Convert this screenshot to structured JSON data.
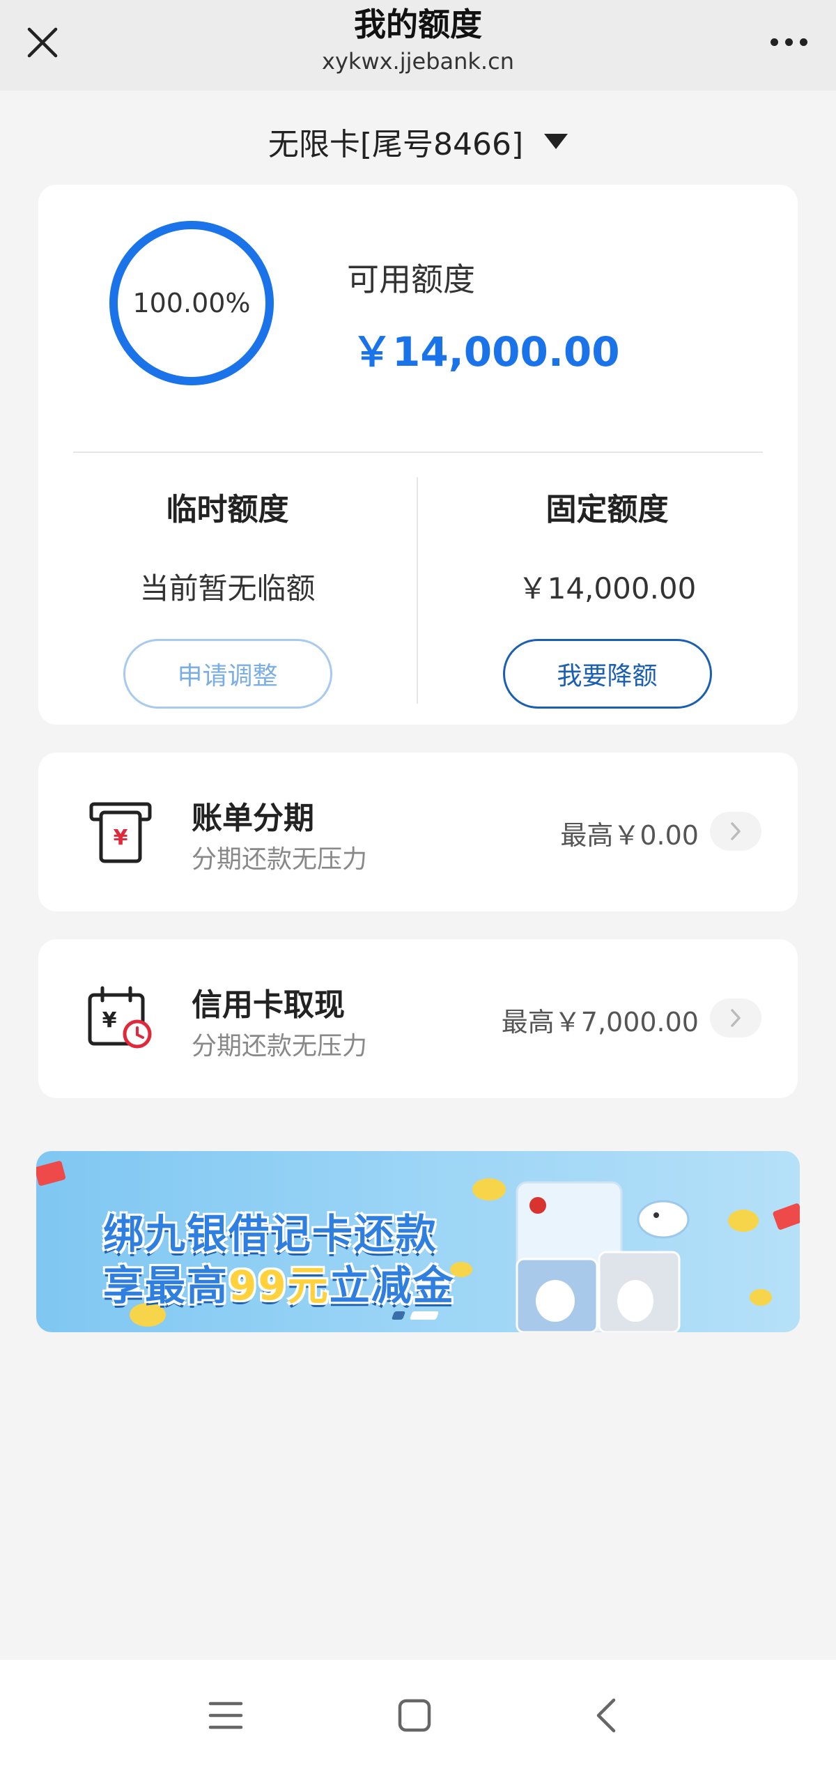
{
  "header": {
    "title": "我的额度",
    "subtitle": "xykwx.jjebank.cn",
    "close_icon": "close-icon",
    "more_icon": "more-dots-icon"
  },
  "card_selector": {
    "label": "无限卡[尾号8466]",
    "caret_icon": "triangle-down-icon"
  },
  "quota": {
    "available_ratio_text": "100.00%",
    "available_ratio": 1.0,
    "available_label": "可用额度",
    "available_amount": "￥14,000.00",
    "accent_color": "#1a73e8",
    "temporary": {
      "title": "临时额度",
      "value": "当前暂无临额",
      "button": "申请调整"
    },
    "fixed": {
      "title": "固定额度",
      "value": "￥14,000.00",
      "button": "我要降额"
    }
  },
  "services": [
    {
      "icon": "bill-installment-icon",
      "title": "账单分期",
      "subtitle": "分期还款无压力",
      "amount": "最高￥0.00"
    },
    {
      "icon": "cash-withdrawal-calendar-icon",
      "title": "信用卡取现",
      "subtitle": "分期还款无压力",
      "amount": "最高￥7,000.00"
    }
  ],
  "banner": {
    "line1": "绑九银借记卡还款",
    "line2_prefix": "享最高",
    "line2_highlight": "99元",
    "line2_suffix": "立减金",
    "slide_count": 2,
    "active_slide": 1
  },
  "system_nav": {
    "menu_icon": "menu-icon",
    "home_icon": "home-square-icon",
    "back_icon": "back-chevron-icon"
  }
}
